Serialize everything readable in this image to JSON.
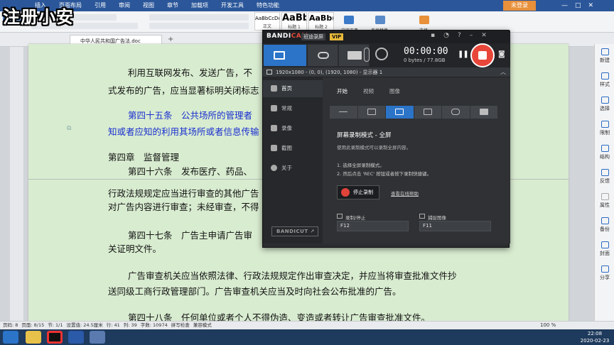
{
  "overlay": {
    "title": "注册小安"
  },
  "ribbon": {
    "tabs": [
      "插入",
      "页面布局",
      "引用",
      "审阅",
      "视图",
      "章节",
      "加载项",
      "开发工具",
      "特色功能"
    ],
    "login": "未登录",
    "window_controls": [
      "—",
      "□",
      "✕"
    ],
    "styles": [
      {
        "sample": "AaBbCcDd",
        "name": "正文"
      },
      {
        "sample": "AaBb",
        "name": "标题 1"
      },
      {
        "sample": "AaBb(",
        "name": "标题 2"
      }
    ],
    "text_tools_label": "文字工具",
    "find_replace_label": "查找替换",
    "select_label": "选择"
  },
  "tabbar": {
    "doc_title": "中华人民共和国广告法.doc",
    "add_tab": "+"
  },
  "document": {
    "lines": [
      {
        "text": "利用互联网发布、发送广告，不",
        "color": "#111111"
      },
      {
        "text": "式发布的广告，应当显著标明关闭标志",
        "color": "#111111"
      },
      {
        "text": "第四十五条　公共场所的管理者",
        "color": "#1a2fd0"
      },
      {
        "text": "知或者应知的利用其场所或者信息传输",
        "color": "#1a2fd0"
      },
      {
        "text": "第四章　监督管理",
        "color": "#111111"
      },
      {
        "text": "第四十六条　发布医疗、药品、",
        "color": "#111111"
      },
      {
        "text": "行政法规规定应当进行审查的其他广告",
        "color": "#111111"
      },
      {
        "text": "对广告内容进行审查；未经审查，不得",
        "color": "#111111"
      },
      {
        "text": "第四十七条　广告主申请广告审",
        "color": "#111111"
      },
      {
        "text": "关证明文件。",
        "color": "#111111"
      },
      {
        "text": "广告审查机关应当依照法律、行政法规规定作出审查决定，并应当将审查批准文件抄",
        "color": "#111111"
      },
      {
        "text": "送同级工商行政管理部门。广告审查机关应当及时向社会公布批准的广告。",
        "color": "#111111"
      },
      {
        "text": "第四十八条　任何单位或者个人不得伪造、变造或者转让广告审查批准文件。",
        "color": "#111111"
      }
    ]
  },
  "right_panel": {
    "items": [
      "新建",
      "样式",
      "选择",
      "限制",
      "结构",
      "反馈",
      "属性",
      "备份",
      "封面",
      "分享"
    ]
  },
  "status": {
    "items": [
      "页码: 8",
      "页面: 8/15",
      "节: 1/1",
      "设置值: 24.5厘米",
      "行: 41",
      "列: 39",
      "字数: 10974",
      "拼写检查",
      "兼容模式"
    ],
    "zoom": "100 %"
  },
  "taskbar": {
    "time": "22:08",
    "date": "2020-02-23"
  },
  "bandicam": {
    "logo_a": "BANDI",
    "logo_b": "CAM",
    "subtitle": "班迪录屏",
    "vip": "VIP",
    "timer": "00:00:00",
    "bytes": "0 bytes / 77.8GB",
    "capture_info": "1920x1080 - (0, 0), (1920, 1080) - 显示器 1",
    "sidebar": [
      "首页",
      "常规",
      "录像",
      "截图",
      "关于"
    ],
    "bandicut": "BANDICUT ↗",
    "tabs": [
      "开始",
      "视频",
      "图像"
    ],
    "heading": "屏幕录制模式 - 全屏",
    "heading_desc": "使用此录制模式可以录制全屏内容。",
    "step1": "1. 选择全屏录制模式。",
    "step2": "2. 然后点击 'REC' 按钮或者按下录制快捷键。",
    "stop_label": "停止录制",
    "help_link": "查看在线帮助",
    "hotkey_label1": "录制/停止",
    "hotkey_label2": "捕捉图像",
    "hotkey_value1": "F12",
    "hotkey_value2": "F11",
    "accent_color": "#2b74c8",
    "record_color": "#e9463a"
  }
}
